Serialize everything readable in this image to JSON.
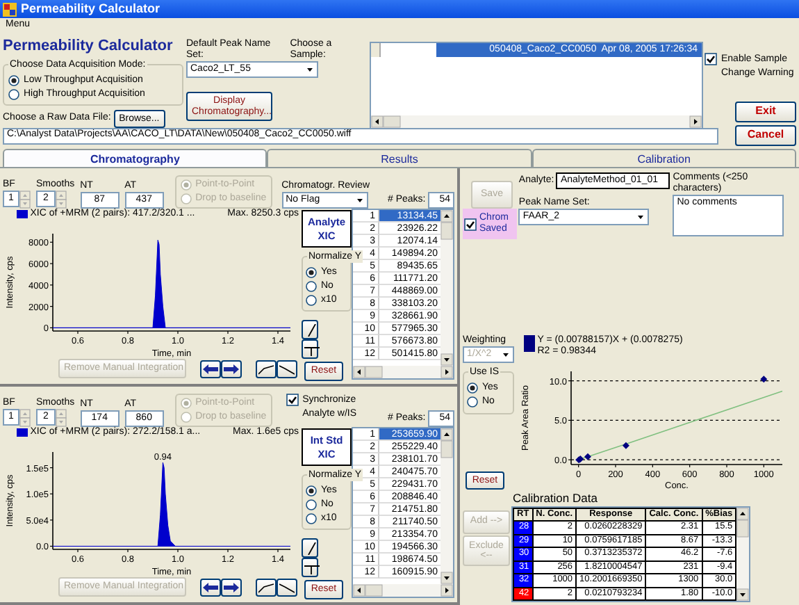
{
  "window": {
    "title": "Permeability Calculator"
  },
  "menu": [
    "Menu"
  ],
  "header": {
    "title": "Permeability Calculator",
    "acquisition": {
      "legend": "Choose Data Acquisition Mode:",
      "options": [
        {
          "label": "Low Throughput Acquisition",
          "selected": true
        },
        {
          "label": "High Throughput Acquisition",
          "selected": false
        }
      ]
    },
    "peak_name_set": {
      "label": "Default Peak Name Set:",
      "value": "Caco2_LT_55"
    },
    "display_button": "Display Chromatography...",
    "sample": {
      "label": "Choose a Sample:",
      "rows": [
        {
          "name": "050408_Caco2_CC0050",
          "date": "Apr 08, 2005  17:26:34",
          "selected": true
        }
      ]
    },
    "warning": {
      "label": "Enable Sample Change Warning",
      "checked": true
    },
    "raw_file": {
      "label": "Choose a Raw Data File:",
      "button": "Browse...",
      "path": "C:\\Analyst Data\\Projects\\AA\\CACO_LT\\DATA\\New\\050408_Caco2_CC0050.wiff"
    },
    "exit": "Exit",
    "cancel": "Cancel"
  },
  "tabs": [
    {
      "label": "Chromatography",
      "selected": true
    },
    {
      "label": "Results",
      "selected": false
    },
    {
      "label": "Calibration",
      "selected": false
    }
  ],
  "chromatograms": [
    {
      "bf": {
        "label": "BF",
        "value": "1"
      },
      "smooths": {
        "label": "Smooths",
        "value": "2"
      },
      "nt": {
        "label": "NT",
        "value": "87"
      },
      "at": {
        "label": "AT",
        "value": "437"
      },
      "integration": {
        "disabled": true,
        "options": [
          {
            "label": "Point-to-Point",
            "selected": true
          },
          {
            "label": "Drop to baseline",
            "selected": false
          }
        ]
      },
      "review": {
        "label": "Chromatogr. Review",
        "value": "No Flag"
      },
      "peaks_label": "# Peaks:",
      "peaks_count": "54",
      "legend": "XIC of +MRM (2 pairs): 417.2/320.1 ...",
      "max": "Max. 8250.3 cps",
      "chart_data": {
        "type": "area",
        "xlabel": "Time, min",
        "ylabel": "Intensity, cps",
        "x": [
          0.5,
          0.89,
          0.9,
          0.91,
          0.92,
          0.925,
          0.93,
          0.94,
          0.95,
          0.97,
          1.45
        ],
        "series": [
          {
            "color": "#0000cc",
            "values": [
              0,
              0,
              0,
              3000,
              8200,
              7800,
              5000,
              2000,
              0,
              0,
              0
            ]
          }
        ],
        "xlim": [
          0.5,
          1.45
        ],
        "ylim": [
          -300,
          8800
        ],
        "xticks": [
          0.6,
          0.8,
          {
            "value": 1,
            "label": "1.0"
          },
          1.2,
          1.4
        ],
        "yticks": [
          0,
          2000,
          4000,
          6000,
          8000
        ]
      },
      "xic_label": "Analyte XIC",
      "normalize": {
        "legend": "Normalize Y",
        "options": [
          {
            "label": "Yes",
            "selected": true
          },
          {
            "label": "No",
            "selected": false
          },
          {
            "label": "x10",
            "selected": false
          }
        ]
      },
      "reset": "Reset",
      "remove_button": {
        "label": "Remove Manual Integration",
        "disabled": true
      },
      "peaks": [
        {
          "index": "1",
          "area": "13134.45",
          "selected": true
        },
        {
          "index": "2",
          "area": "23926.22",
          "selected": false
        },
        {
          "index": "3",
          "area": "12074.14",
          "selected": false
        },
        {
          "index": "4",
          "area": "149894.20",
          "selected": false
        },
        {
          "index": "5",
          "area": "89435.65",
          "selected": false
        },
        {
          "index": "6",
          "area": "111771.20",
          "selected": false
        },
        {
          "index": "7",
          "area": "448869.00",
          "selected": false
        },
        {
          "index": "8",
          "area": "338103.20",
          "selected": false
        },
        {
          "index": "9",
          "area": "328661.90",
          "selected": false
        },
        {
          "index": "10",
          "area": "577965.30",
          "selected": false
        },
        {
          "index": "11",
          "area": "576673.80",
          "selected": false
        },
        {
          "index": "12",
          "area": "501415.80",
          "selected": false
        }
      ]
    },
    {
      "bf": {
        "label": "BF",
        "value": "1"
      },
      "smooths": {
        "label": "Smooths",
        "value": "2"
      },
      "nt": {
        "label": "NT",
        "value": "174"
      },
      "at": {
        "label": "AT",
        "value": "860"
      },
      "integration": {
        "disabled": true,
        "options": [
          {
            "label": "Point-to-Point",
            "selected": true
          },
          {
            "label": "Drop to baseline",
            "selected": false
          }
        ]
      },
      "sync": {
        "label": "Synchronize Analyte w/IS",
        "checked": true
      },
      "peaks_label": "# Peaks:",
      "peaks_count": "54",
      "legend": "XIC of +MRM (2 pairs): 272.2/158.1 a...",
      "max": "Max. 1.6e5 cps",
      "chart_data": {
        "type": "area",
        "xlabel": "Time, min",
        "ylabel": "Intensity, cps",
        "x": [
          0.5,
          0.91,
          0.92,
          0.93,
          0.94,
          0.945,
          0.95,
          0.96,
          0.97,
          0.99,
          1.45
        ],
        "series": [
          {
            "color": "#0000cc",
            "values": [
              0,
              0,
              0,
              60000,
              160000,
              150000,
              100000,
              40000,
              10000,
              0,
              0
            ]
          }
        ],
        "xlim": [
          0.5,
          1.45
        ],
        "ylim": [
          -6000,
          180000
        ],
        "xticks": [
          0.6,
          0.8,
          {
            "value": 1,
            "label": "1.0"
          },
          1.2,
          1.4
        ],
        "yticks": [
          {
            "value": 0,
            "label": "0.0"
          },
          {
            "value": 50000,
            "label": "5.0e4"
          },
          {
            "value": 100000,
            "label": "1.0e5"
          },
          {
            "value": 150000,
            "label": "1.5e5"
          }
        ]
      },
      "peak_label": "0.94",
      "xic_label": "Int Std XIC",
      "normalize": {
        "legend": "Normalize Y",
        "options": [
          {
            "label": "Yes",
            "selected": true
          },
          {
            "label": "No",
            "selected": false
          },
          {
            "label": "x10",
            "selected": false
          }
        ]
      },
      "reset": "Reset",
      "remove_button": {
        "label": "Remove Manual Integration",
        "disabled": true
      },
      "peaks": [
        {
          "index": "1",
          "area": "253659.90",
          "selected": true
        },
        {
          "index": "2",
          "area": "255229.40",
          "selected": false
        },
        {
          "index": "3",
          "area": "238101.70",
          "selected": false
        },
        {
          "index": "4",
          "area": "240475.70",
          "selected": false
        },
        {
          "index": "5",
          "area": "229431.70",
          "selected": false
        },
        {
          "index": "6",
          "area": "208846.40",
          "selected": false
        },
        {
          "index": "7",
          "area": "214751.80",
          "selected": false
        },
        {
          "index": "8",
          "area": "211740.50",
          "selected": false
        },
        {
          "index": "9",
          "area": "213354.70",
          "selected": false
        },
        {
          "index": "10",
          "area": "194566.30",
          "selected": false
        },
        {
          "index": "11",
          "area": "198674.50",
          "selected": false
        },
        {
          "index": "12",
          "area": "160915.90",
          "selected": false
        }
      ]
    }
  ],
  "calibration": {
    "save": {
      "label": "Save",
      "disabled": true
    },
    "chrom_saved": {
      "label": "Chrom Saved",
      "checked": true
    },
    "analyte": {
      "label": "Analyte:",
      "value": "AnalyteMethod_01_01"
    },
    "peak_name_set": {
      "label": "Peak Name Set:",
      "value": "FAAR_2"
    },
    "comments": {
      "label": "Comments (<250 characters)",
      "value": "No comments"
    },
    "weighting": {
      "label": "Weighting",
      "value": "1/X^2",
      "disabled": true
    },
    "equation": "Y = (0.00788157)X + (0.0078275)",
    "r2": "R2 = 0.98344",
    "use_is": {
      "legend": "Use IS",
      "options": [
        {
          "label": "Yes",
          "selected": true
        },
        {
          "label": "No",
          "selected": false
        }
      ]
    },
    "chart_data": {
      "type": "scatter",
      "xlabel": "Conc.",
      "ylabel": "Peak Area Ratio",
      "x": [
        0,
        2,
        10,
        50,
        256,
        1000,
        1100
      ],
      "series": [
        {
          "color": "#000080",
          "values": [
            null,
            0.0,
            0.1,
            0.4,
            1.8,
            10.2,
            null
          ]
        },
        {
          "type": "line",
          "color": "#80c080",
          "values": [
            0.0,
            0.0,
            0.1,
            0.4,
            2.0,
            7.9,
            8.7
          ]
        }
      ],
      "xlim": [
        -40,
        1100
      ],
      "ylim": [
        -0.6,
        11.2
      ],
      "xticks": [
        0,
        200,
        400,
        600,
        800,
        1000
      ],
      "yticks": [
        {
          "value": 0,
          "label": "0.0"
        },
        {
          "value": 5,
          "label": "5.0"
        },
        {
          "value": 10,
          "label": "10.0"
        }
      ],
      "grid": true
    },
    "reset": "Reset",
    "table_title": "Calibration Data",
    "add": {
      "label": "Add -->",
      "disabled": true
    },
    "exclude": {
      "label": "Exclude <--",
      "disabled": true
    },
    "columns": [
      "RT",
      "N. Conc.",
      "Response",
      "Calc. Conc.",
      "%Bias"
    ],
    "rows": [
      {
        "color": "#0000ff",
        "cells": [
          "28",
          "2",
          "0.0260228329",
          "2.31",
          "15.5"
        ]
      },
      {
        "color": "#0000ff",
        "cells": [
          "29",
          "10",
          "0.0759617185",
          "8.67",
          "-13.3"
        ]
      },
      {
        "color": "#0000ff",
        "cells": [
          "30",
          "50",
          "0.3713235372",
          "46.2",
          "-7.6"
        ]
      },
      {
        "color": "#0000ff",
        "cells": [
          "31",
          "256",
          "1.8210004547",
          "231",
          "-9.4"
        ]
      },
      {
        "color": "#0000ff",
        "cells": [
          "32",
          "1000",
          "10.2001669350",
          "1300",
          "30.0"
        ]
      },
      {
        "color": "#ff0000",
        "cells": [
          "42",
          "2",
          "0.0210793234",
          "1.80",
          "-10.0"
        ]
      }
    ]
  }
}
